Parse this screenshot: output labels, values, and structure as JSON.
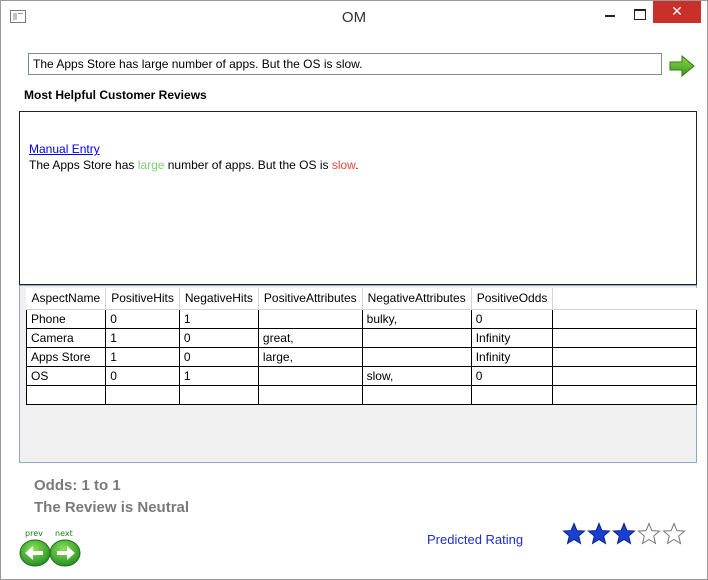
{
  "window": {
    "title": "OM",
    "close_glyph": "✕",
    "app_icon": "window-app-icon"
  },
  "input": {
    "value": "The Apps Store has large number of apps. But the OS is slow."
  },
  "go_button": {
    "icon": "green-right-arrow-icon"
  },
  "section": {
    "title": "Most Helpful Customer Reviews"
  },
  "review": {
    "link_text": "Manual Entry",
    "parts": {
      "p1": "The Apps Store has ",
      "pos_word": "large",
      "p2": " number of apps. But the OS is ",
      "neg_word": "slow",
      "p3": "."
    },
    "colors": {
      "positive": "#7fd16c",
      "negative": "#e8453c"
    }
  },
  "table": {
    "columns": [
      "AspectName",
      "PositiveHits",
      "NegativeHits",
      "PositiveAttributes",
      "NegativeAttributes",
      "PositiveOdds"
    ],
    "rows": [
      [
        "Phone",
        "0",
        "1",
        "",
        "bulky,",
        "0"
      ],
      [
        "Camera",
        "1",
        "0",
        "great,",
        "",
        "Infinity"
      ],
      [
        "Apps Store",
        "1",
        "0",
        "large,",
        "",
        "Infinity"
      ],
      [
        "OS",
        "0",
        "1",
        "",
        "slow,",
        "0"
      ],
      [
        "",
        "",
        "",
        "",
        "",
        ""
      ]
    ]
  },
  "result": {
    "odds": "Odds: 1 to 1",
    "verdict": "The Review is Neutral"
  },
  "nav": {
    "prev_label": "prev",
    "next_label": "next"
  },
  "rating": {
    "label": "Predicted Rating",
    "value": 3,
    "max": 5,
    "filled_color": "#1a3fd6"
  }
}
